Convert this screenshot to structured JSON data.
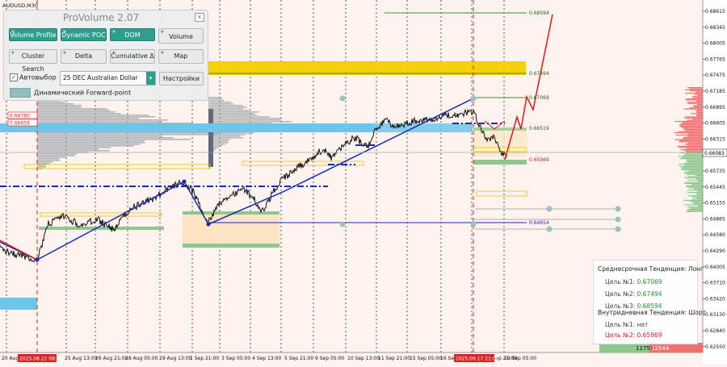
{
  "symbol": "AUDUSD,M30",
  "price_axis": {
    "labels": [
      "0.68615",
      "0.68345",
      "0.68005",
      "0.67765",
      "0.67475",
      "0.67185",
      "0.66895",
      "0.66605",
      "0.66315",
      "0.66083",
      "0.65735",
      "0.65445",
      "0.65155",
      "0.64865",
      "0.64580",
      "0.64290",
      "0.64005",
      "0.63710",
      "0.63420",
      "0.63130",
      "0.62840",
      "0.62550"
    ],
    "current": "0.66083"
  },
  "time_axis": {
    "labels": [
      "20 Aug 2025",
      "25 Aug 13:00",
      "26 Aug 21:00",
      "28 Aug 05:00",
      "29 Aug 13:00",
      "1 Sep 21:00",
      "3 Sep 05:00",
      "4 Sep 13:00",
      "5 Sep 21:00",
      "9 Sep 05:00",
      "10 Sep 13:00",
      "11 Sep 21:00",
      "15 Sep 05:00",
      "16 Sep 13:00",
      "18 Sep 21:00",
      "19 Sep 05:00"
    ],
    "marker1": "2025.08.22 08:30",
    "marker2": "2025.09.17 21:00"
  },
  "levels": {
    "l1": "0.68594",
    "l2": "0.67494",
    "l3": "0.67069",
    "l4": "0.66519",
    "l5": "0.65969",
    "l6": "0.64654",
    "red1": "0.66780",
    "red2": "0.66659"
  },
  "panel": {
    "title": "ProVolume 2.07",
    "close": "x",
    "buttons": {
      "volume_profile": "Volume Profile",
      "dynamic_poc": "Dynamic POC",
      "dom": "DOM",
      "volume": "Volume",
      "cluster_search": "Cluster Search",
      "delta": "Delta",
      "cumulative_delta": "Cumulative Δ",
      "map": "Map"
    },
    "autoselect_label": "Автовыбор",
    "contract_value": "25 DEC Australian Dollar",
    "settings_button": "Настройки",
    "forward_point_label": "Динамический Forward-point"
  },
  "trend_box": {
    "mid_title": "Среднесрочная Тенденция: Лонг",
    "mid_targets": [
      {
        "label": "Цель №1:",
        "value": "0.67069"
      },
      {
        "label": "Цель №2:",
        "value": "0.67494"
      },
      {
        "label": "Цель №3:",
        "value": "0.68594"
      }
    ],
    "intra_title": "Внутридневная Тенденция: Шорт",
    "intra_targets": [
      {
        "label": "Цель №1:",
        "value": "нет"
      },
      {
        "label": "Цель №2:",
        "value": "0.65969"
      }
    ]
  },
  "dom_bar": {
    "bid": "11757",
    "ask": "11544"
  },
  "colors": {
    "background": "#fdf3ee",
    "price_line": "#111111",
    "trend_line": "#1a2ab0",
    "level_green": "#2e9a2e",
    "zone_yellow": "#f5cc00",
    "zone_blue": "#6ec5ea",
    "ask_red": "#f07070",
    "bid_green": "#8fc88f",
    "accent_teal": "#2e9e8e"
  }
}
